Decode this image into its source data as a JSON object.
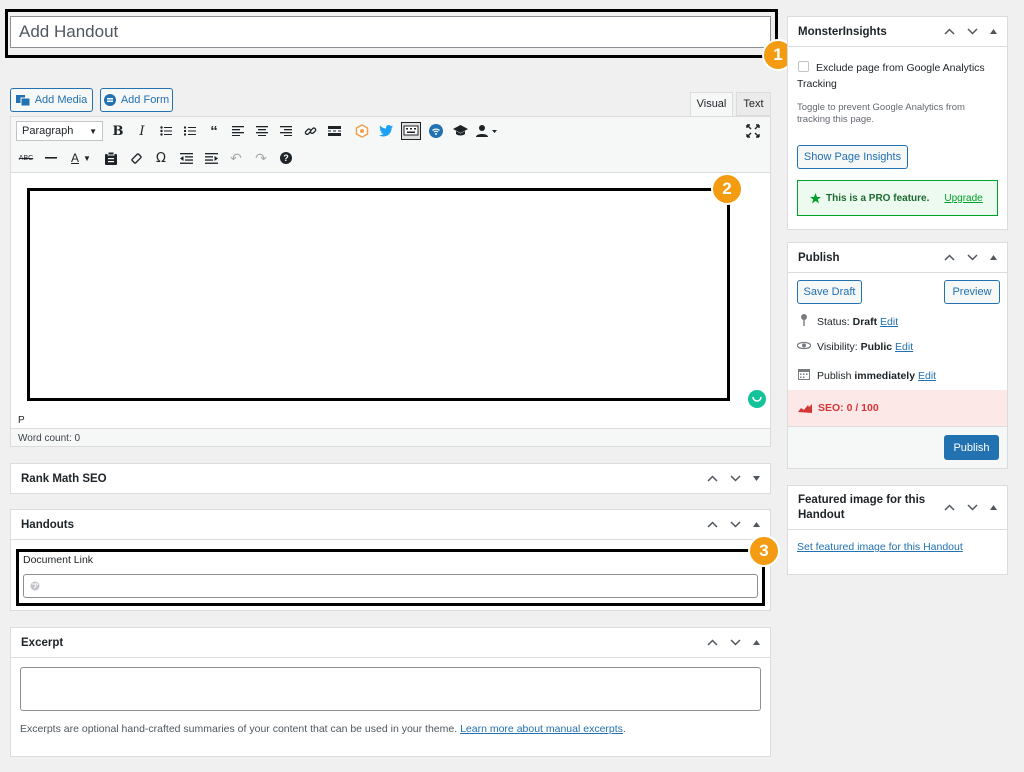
{
  "title": {
    "value": "Add Handout"
  },
  "media": {
    "add_media": "Add Media",
    "add_form": "Add Form"
  },
  "editor": {
    "tabs": {
      "visual": "Visual",
      "text": "Text"
    },
    "format_select": "Paragraph",
    "path": "P",
    "word_count": "Word count: 0"
  },
  "callouts": {
    "one": "1",
    "two": "2",
    "three": "3"
  },
  "rank_math": {
    "title": "Rank Math SEO"
  },
  "handouts": {
    "title": "Handouts",
    "doc_link_label": "Document Link"
  },
  "excerpt": {
    "title": "Excerpt",
    "help_text": "Excerpts are optional hand-crafted summaries of your content that can be used in your theme.",
    "help_link": "Learn more about manual excerpts",
    "help_end": "."
  },
  "monsterinsights": {
    "title": "MonsterInsights",
    "exclude_label": "Exclude page from Google Analytics Tracking",
    "help": "Toggle to prevent Google Analytics from tracking this page.",
    "show_insights": "Show Page Insights",
    "pro_text": "This is a PRO feature.",
    "upgrade": "Upgrade"
  },
  "publish": {
    "title": "Publish",
    "save_draft": "Save Draft",
    "preview": "Preview",
    "status_label": "Status:",
    "status_value": "Draft",
    "visibility_label": "Visibility:",
    "visibility_value": "Public",
    "publish_label": "Publish",
    "publish_value": "immediately",
    "edit": "Edit",
    "seo": "SEO: 0 / 100",
    "publish_btn": "Publish"
  },
  "featured": {
    "title": "Featured image for this Handout",
    "set_link": "Set featured image for this Handout"
  },
  "colors": {
    "accent": "#2271b1",
    "callout_badge": "#f39c12",
    "pro_green": "#00a32a",
    "seo_red": "#d63638"
  }
}
